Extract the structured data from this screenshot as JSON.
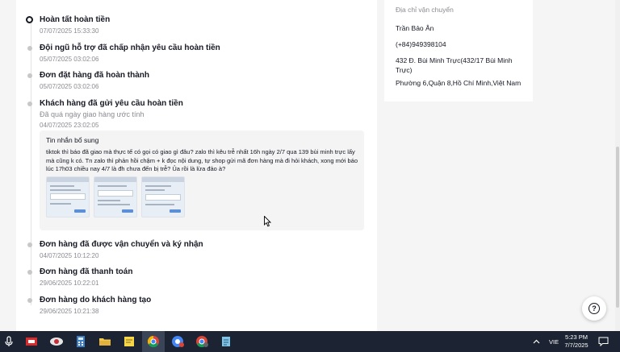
{
  "timeline": [
    {
      "title": "Hoàn tất hoàn tiền",
      "date": "07/07/2025 15:33:30"
    },
    {
      "title": "Đội ngũ hỗ trợ đã chấp nhận yêu cầu hoàn tiền",
      "date": "05/07/2025 03:02:06"
    },
    {
      "title": "Đơn đặt hàng đã hoàn thành",
      "date": "05/07/2025 03:02:06"
    },
    {
      "title": "Khách hàng đã gửi yêu cầu hoàn tiền",
      "subtitle": "Đã quá ngày giao hàng ước tính",
      "date": "04/07/2025 23:02:05"
    },
    {
      "title": "Đơn hàng đã được vận chuyển và ký nhận",
      "date": "04/07/2025 10:12:20"
    },
    {
      "title": "Đơn hàng đã thanh toán",
      "date": "29/06/2025 10:22:01"
    },
    {
      "title": "Đơn hàng do khách hàng tạo",
      "date": "29/06/2025 10:21:38"
    }
  ],
  "note": {
    "title": "Tin nhắn bổ sung",
    "body": "tiktok thì báo đã giao mà thực tế có gọi có giao gì đâu? zalo thì kêu trễ nhất 16h ngày 2/7 qua 139 bùi minh trực lấy mà cũng k có. Tn zalo thì phản hồi chậm + k đọc nội dung, tự shop gửi mã đơn hàng mà đi hỏi khách, xong mới báo lúc 17h03 chiều nay 4/7 là đh chưa đến bị trễ? Ủa rồi là lừa đảo à?",
    "attachments": 3
  },
  "address": {
    "label": "Địa chỉ vận chuyển",
    "name": "Trần Bảo Ân",
    "phone": "(+84)949398104",
    "street": "432 Đ. Bùi Minh Trực(432/17 Bùi Minh Trực)",
    "ward": "Phường 6,Quận 8,Hồ Chí Minh,Việt Nam"
  },
  "help": {
    "icon": "help-icon",
    "glyph": "?"
  },
  "taskbar": {
    "apps": [
      "mic-icon",
      "game-icon",
      "app-icon",
      "calculator-icon",
      "file-explorer-icon",
      "sticky-notes-icon",
      "chrome-icon",
      "chrome-profile-icon",
      "chrome-profile-2-icon",
      "notepad-icon"
    ],
    "tray_language": "VIE",
    "clock_time": "5:23 PM",
    "clock_date": "7/7/2025"
  },
  "colors": {
    "text": "#161823",
    "muted": "#8a8b91",
    "taskbar": "#1c2433",
    "card": "#ffffff",
    "page": "#f5f5f5"
  }
}
